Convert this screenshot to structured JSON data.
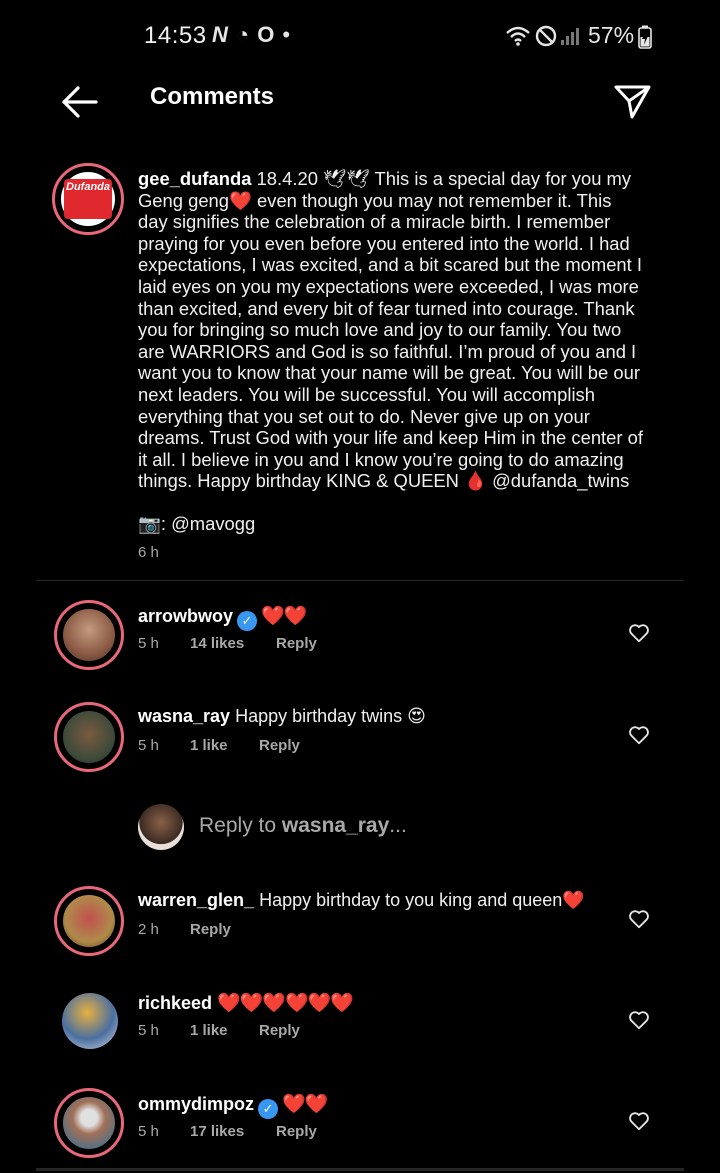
{
  "status_bar": {
    "time": "14:53",
    "left_icons": [
      "N",
      "◔",
      "O",
      "•"
    ],
    "battery": "57%"
  },
  "header": {
    "title": "Comments"
  },
  "post": {
    "username": "gee_dufanda",
    "avatar_text": "Dufanda",
    "caption": "18.4.20 🕊🕊 This is a special day for you my Geng geng❤️ even though you may not remember it. This day signifies the celebration of a miracle birth. I remember praying for you even before you entered into the world. I had expectations, I was excited, and a bit scared but the moment I laid eyes on you my expectations were exceeded, I was more than excited, and every bit of fear turned into courage. Thank you for bringing so much love and joy to our family. You two are WARRIORS and God is so faithful. I’m proud of you and I want you to know that your name will be great. You will be our next leaders. You will be successful. You will accomplish everything that you set out to do. Never give up on your dreams. Trust God with your life and keep Him in the center of it all. I believe in you and I know you’re going to do amazing things. Happy birthday KING & QUEEN 🩸 @dufanda_twins",
    "photo_credit": "📷: @mavogg",
    "time": "6 h"
  },
  "comments": [
    {
      "username": "arrowbwoy",
      "verified": true,
      "text": "❤️❤️",
      "time": "5 h",
      "likes": "14 likes",
      "reply": "Reply",
      "avatar_color": "#8a5a44"
    },
    {
      "username": "wasna_ray",
      "verified": false,
      "text": "Happy birthday twins 😍",
      "time": "5 h",
      "likes": "1 like",
      "reply": "Reply",
      "avatar_color": "#3d4a3a"
    },
    {
      "username": "warren_glen_",
      "verified": false,
      "text": "Happy birthday to you king and queen❤️",
      "time": "2 h",
      "likes": "",
      "reply": "Reply",
      "avatar_color": "#b08a4a"
    },
    {
      "username": "richkeed",
      "verified": false,
      "text": "❤️❤️❤️❤️❤️❤️",
      "time": "5 h",
      "likes": "1 like",
      "reply": "Reply",
      "avatar_color": "#4a6fa0"
    },
    {
      "username": "ommydimpoz",
      "verified": true,
      "text": "❤️❤️",
      "time": "5 h",
      "likes": "17 likes",
      "reply": "Reply",
      "avatar_color": "#5a7080"
    }
  ],
  "reply_box": {
    "prefix": "Reply to ",
    "target": "wasna_ray",
    "suffix": "..."
  },
  "colors": {
    "background": "#000000",
    "story_ring": "#e8677b",
    "heart_red": "#e8132e",
    "verified_blue": "#3897f0",
    "muted_text": "#a8a8a8"
  }
}
